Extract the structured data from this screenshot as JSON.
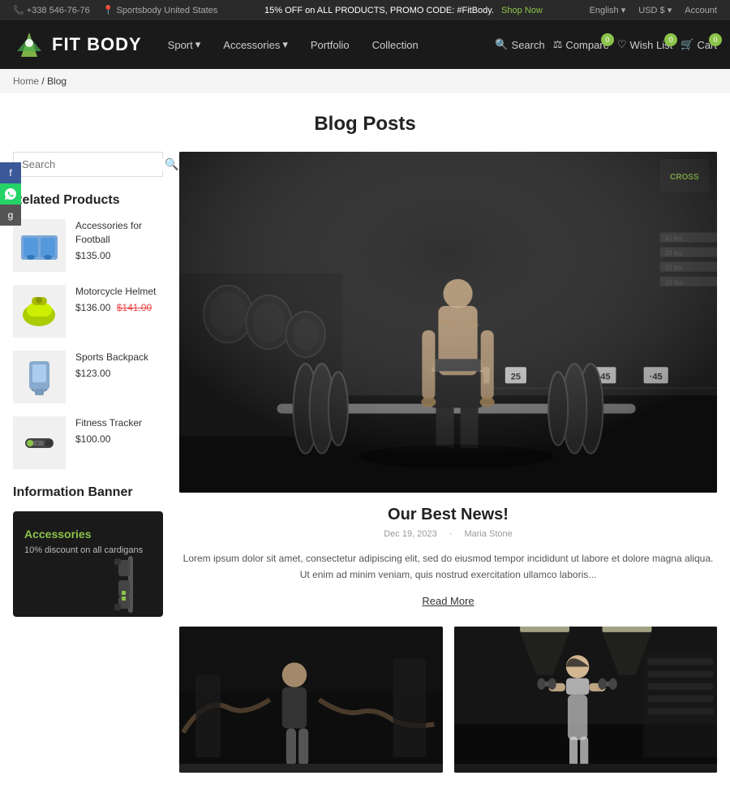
{
  "topBar": {
    "phone": "+338 546-76-76",
    "location": "Sportsbody United States",
    "promo": "15% OFF on ALL PRODUCTS, PROMO CODE: #FitBody.",
    "shopNow": "Shop Now",
    "language": "English",
    "currency": "USD $",
    "account": "Account"
  },
  "header": {
    "logoText": "FIT BODY",
    "nav": [
      {
        "label": "Sport",
        "hasDropdown": true
      },
      {
        "label": "Accessories",
        "hasDropdown": true
      },
      {
        "label": "Portfolio",
        "hasDropdown": false
      },
      {
        "label": "Collection",
        "hasDropdown": false
      }
    ],
    "search": "Search",
    "compare": "Compare",
    "compareBadge": "0",
    "wishlist": "Wish List",
    "wishlistBadge": "0",
    "cart": "Cart",
    "cartBadge": "0"
  },
  "breadcrumb": {
    "home": "Home",
    "current": "Blog"
  },
  "pageTitle": "Blog Posts",
  "sidebar": {
    "searchPlaceholder": "Search",
    "relatedTitle": "Related Products",
    "products": [
      {
        "name": "Accessories for Football",
        "price": "$135.00",
        "originalPrice": null
      },
      {
        "name": "Motorcycle Helmet",
        "price": "$136.00",
        "originalPrice": "$141.00"
      },
      {
        "name": "Sports Backpack",
        "price": "$123.00",
        "originalPrice": null
      },
      {
        "name": "Fitness Tracker",
        "price": "$100.00",
        "originalPrice": null
      }
    ],
    "infoTitle": "Information Banner",
    "bannerCategory": "Accessories",
    "bannerDesc": "10% discount on all cardigans"
  },
  "social": [
    {
      "name": "facebook",
      "label": "f"
    },
    {
      "name": "whatsapp",
      "label": "w"
    },
    {
      "name": "other",
      "label": "g"
    }
  ],
  "blog": {
    "mainPost": {
      "title": "Our Best News!",
      "date": "Dec 19, 2023",
      "author": "Maria Stone",
      "excerpt": "Lorem ipsum dolor sit amet, consectetur adipiscing elit, sed do eiusmod tempor incididunt ut labore et dolore magna aliqua. Ut enim ad minim veniam, quis nostrud exercitation ullamco laboris...",
      "readMore": "Read More"
    },
    "bottomPosts": [
      {
        "id": 1
      },
      {
        "id": 2
      }
    ]
  }
}
